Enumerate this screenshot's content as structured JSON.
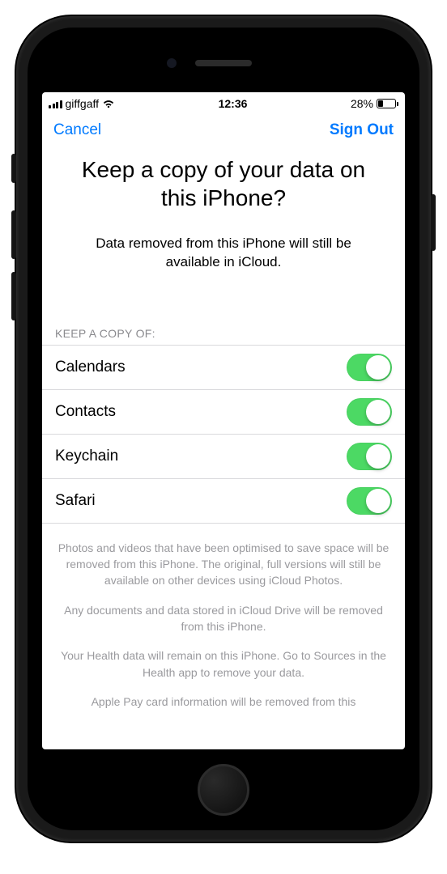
{
  "status": {
    "carrier": "giffgaff",
    "time": "12:36",
    "battery_pct": "28%"
  },
  "nav": {
    "left": "Cancel",
    "right": "Sign Out"
  },
  "title": "Keep a copy of your data on this iPhone?",
  "subtitle": "Data removed from this iPhone will still be available in iCloud.",
  "section_header": "KEEP A COPY OF:",
  "items": [
    {
      "label": "Calendars",
      "on": true
    },
    {
      "label": "Contacts",
      "on": true
    },
    {
      "label": "Keychain",
      "on": true
    },
    {
      "label": "Safari",
      "on": true
    }
  ],
  "footer": {
    "p1": "Photos and videos that have been optimised to save space will be removed from this iPhone. The original, full versions will still be available on other devices using iCloud Photos.",
    "p2": "Any documents and data stored in iCloud Drive will be removed from this iPhone.",
    "p3": "Your Health data will remain on this iPhone. Go to Sources in the Health app to remove your data.",
    "p4": "Apple Pay card information will be removed from this"
  },
  "colors": {
    "link": "#007aff",
    "toggle_on": "#4cd964"
  }
}
